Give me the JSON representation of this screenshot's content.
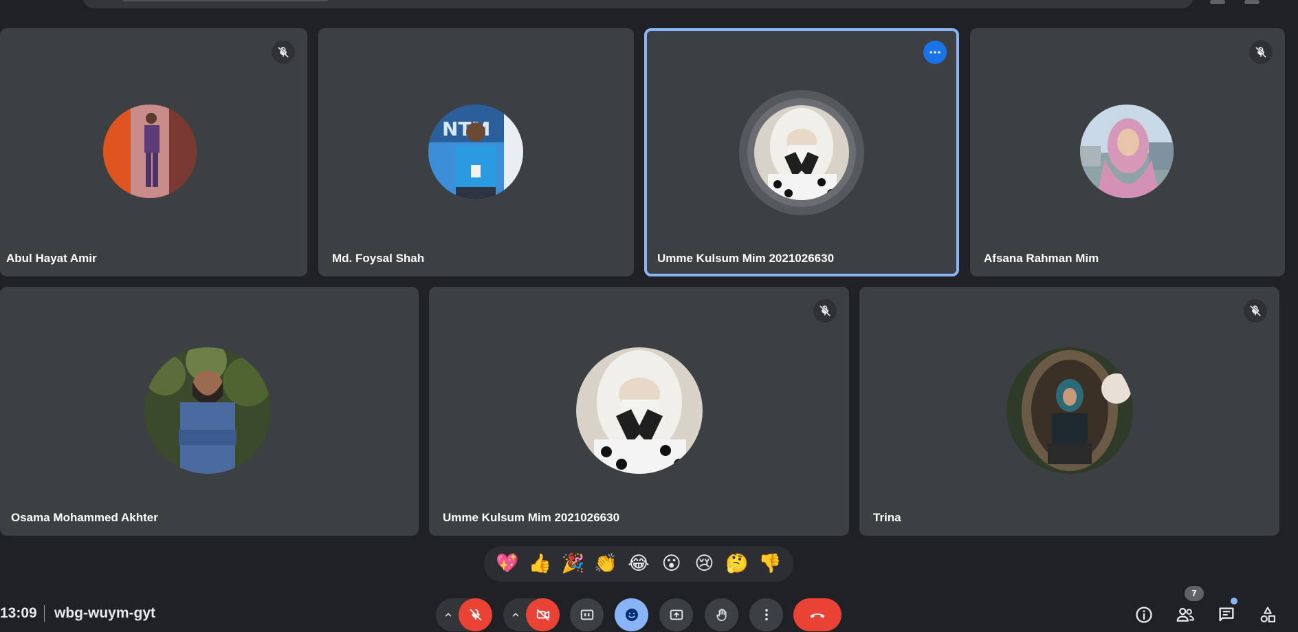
{
  "participants": [
    {
      "name": "Abul Hayat Amir",
      "muted": true
    },
    {
      "name": "Md. Foysal Shah",
      "muted": false
    },
    {
      "name": "Umme Kulsum Mim 2021026630",
      "muted": false,
      "active": true
    },
    {
      "name": "Afsana Rahman Mim",
      "muted": true
    },
    {
      "name": "Osama Mohammed Akhter",
      "muted": false
    },
    {
      "name": "Umme Kulsum Mim 2021026630",
      "muted": true
    },
    {
      "name": "Trina",
      "muted": true
    }
  ],
  "reactions": [
    "💖",
    "👍",
    "🎉",
    "👏",
    "😂",
    "😮",
    "😢",
    "🤔",
    "👎"
  ],
  "meeting": {
    "time": "13:09",
    "code": "wbg-wuym-gyt",
    "participant_count": "7"
  },
  "colors": {
    "background": "#202124",
    "tile": "#3c4043",
    "active_outline": "#8ab4f8",
    "end_call": "#ea4335",
    "accent_blue": "#8ab4f8"
  },
  "icons": {
    "mic": "mic-off-icon",
    "camera": "camera-off-icon",
    "captions": "cc-icon",
    "emoji": "emoji-icon",
    "present": "present-icon",
    "hand": "raise-hand-icon",
    "more": "more-vert-icon",
    "leave": "call-end-icon",
    "info": "info-icon",
    "people": "people-icon",
    "chat": "chat-icon",
    "activities": "activities-icon"
  }
}
